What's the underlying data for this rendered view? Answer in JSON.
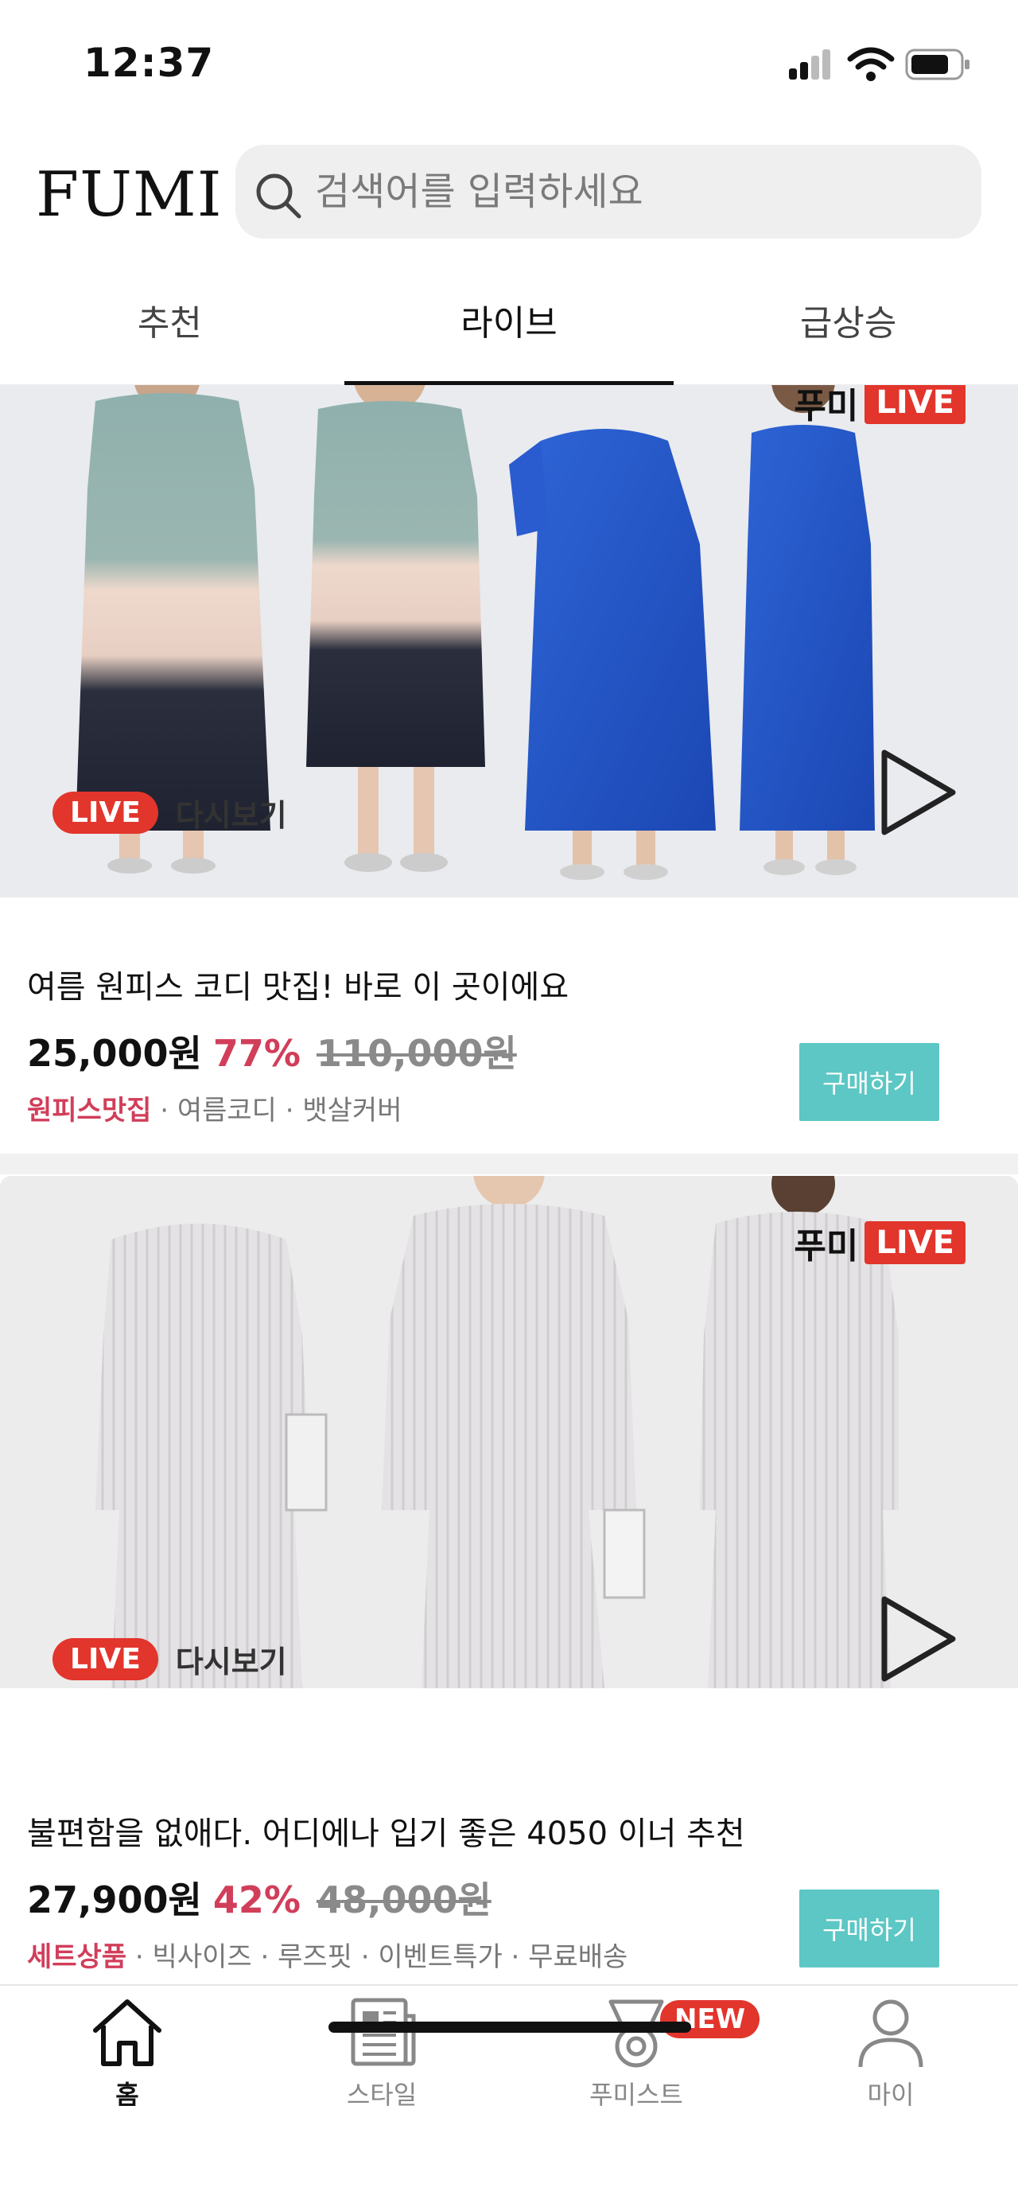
{
  "status_bar": {
    "time": "12:37"
  },
  "header": {
    "logo": "FUMI",
    "search_placeholder": "검색어를 입력하세요"
  },
  "tabs": [
    {
      "label": "추천",
      "active": false
    },
    {
      "label": "라이브",
      "active": true
    },
    {
      "label": "급상승",
      "active": false
    }
  ],
  "cards": [
    {
      "brand_live_text": "푸미",
      "live_badge": "LIVE",
      "replay_badge": "LIVE",
      "replay_label": "다시보기",
      "title": "여름 원피스 코디 맛집! 바로 이 곳이에요",
      "price": "25,000원",
      "discount": "77%",
      "original_price": "110,000원",
      "tag_main": "원피스맛집",
      "tags_rest": " · 여름코디 · 뱃살커버",
      "buy_label": "구매하기"
    },
    {
      "brand_live_text": "푸미",
      "live_badge": "LIVE",
      "replay_badge": "LIVE",
      "replay_label": "다시보기",
      "title": "불편함을 없애다. 어디에나 입기 좋은 4050 이너 추천",
      "price": "27,900원",
      "discount": "42%",
      "original_price": "48,000원",
      "tag_main": "세트상품",
      "tags_rest": " · 빅사이즈 · 루즈핏 · 이벤트특가 · 무료배송",
      "buy_label": "구매하기"
    }
  ],
  "bottom_nav": [
    {
      "label": "홈",
      "icon": "home-icon",
      "active": true
    },
    {
      "label": "스타일",
      "icon": "newspaper-icon",
      "active": false
    },
    {
      "label": "푸미스트",
      "icon": "medal-icon",
      "active": false,
      "badge": "NEW"
    },
    {
      "label": "마이",
      "icon": "person-icon",
      "active": false
    }
  ],
  "colors": {
    "accent_red": "#e2352c",
    "price_pink": "#d13e5a",
    "buy_teal": "#5cc7c4"
  }
}
